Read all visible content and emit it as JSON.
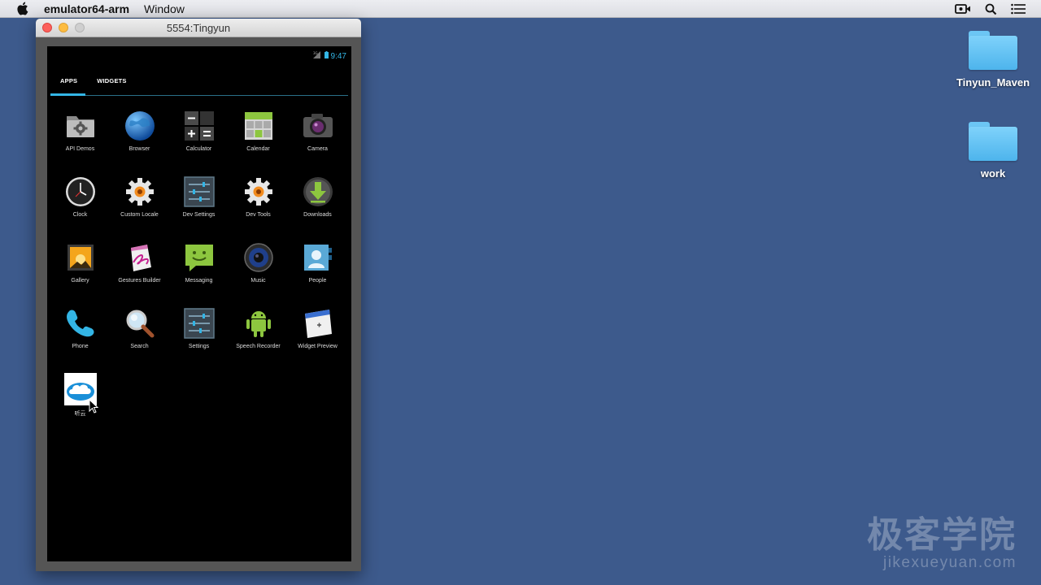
{
  "menubar": {
    "app_name": "emulator64-arm",
    "menu_window": "Window"
  },
  "desktop": {
    "folders": [
      {
        "label": "Tinyun_Maven"
      },
      {
        "label": "work"
      }
    ]
  },
  "emulator": {
    "title": "5554:Tingyun",
    "status_time": "9:47",
    "tabs": [
      {
        "label": "APPS",
        "active": true
      },
      {
        "label": "WIDGETS",
        "active": false
      }
    ],
    "apps": [
      {
        "label": "API Demos",
        "icon": "folder-gear-icon"
      },
      {
        "label": "Browser",
        "icon": "globe-icon"
      },
      {
        "label": "Calculator",
        "icon": "calculator-icon"
      },
      {
        "label": "Calendar",
        "icon": "calendar-icon"
      },
      {
        "label": "Camera",
        "icon": "camera-icon"
      },
      {
        "label": "Clock",
        "icon": "clock-icon"
      },
      {
        "label": "Custom Locale",
        "icon": "gear-icon"
      },
      {
        "label": "Dev Settings",
        "icon": "sliders-icon"
      },
      {
        "label": "Dev Tools",
        "icon": "gear-icon"
      },
      {
        "label": "Downloads",
        "icon": "download-icon"
      },
      {
        "label": "Gallery",
        "icon": "picture-icon"
      },
      {
        "label": "Gestures Builder",
        "icon": "gesture-icon"
      },
      {
        "label": "Messaging",
        "icon": "message-icon"
      },
      {
        "label": "Music",
        "icon": "speaker-icon"
      },
      {
        "label": "People",
        "icon": "contact-icon"
      },
      {
        "label": "Phone",
        "icon": "phone-icon"
      },
      {
        "label": "Search",
        "icon": "magnifier-icon"
      },
      {
        "label": "Settings",
        "icon": "sliders-icon"
      },
      {
        "label": "Speech Recorder",
        "icon": "android-icon"
      },
      {
        "label": "Widget Preview",
        "icon": "widget-icon"
      },
      {
        "label": "听云",
        "icon": "cloud-icon"
      }
    ]
  },
  "watermark": {
    "name_cn": "极客学院",
    "url": "jikexueyuan.com"
  }
}
